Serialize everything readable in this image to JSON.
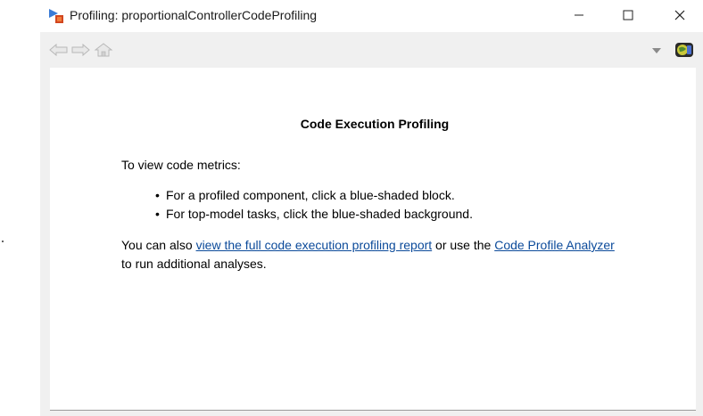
{
  "window": {
    "title": "Profiling: proportionalControllerCodeProfiling",
    "controls": [
      "minimize-icon",
      "maximize-icon",
      "close-icon"
    ]
  },
  "toolbar": {
    "icons": [
      "back-arrow-icon",
      "forward-arrow-icon",
      "home-icon",
      "dropdown-arrow-icon",
      "globe-icon"
    ]
  },
  "content": {
    "heading": "Code Execution Profiling",
    "intro": "To view code metrics:",
    "bullets": [
      "For a profiled component, click a blue-shaded block.",
      "For top-model tasks, click the blue-shaded background."
    ],
    "paragraph": {
      "text1": "You can also ",
      "link1": "view the full code execution profiling report",
      "text2": " or use the ",
      "link2": "Code Profile Analyzer",
      "text3": " to run additional analyses."
    }
  },
  "colors": {
    "link": "#0b4a9a",
    "window_bg": "#f0f0f0",
    "content_bg": "#ffffff"
  }
}
